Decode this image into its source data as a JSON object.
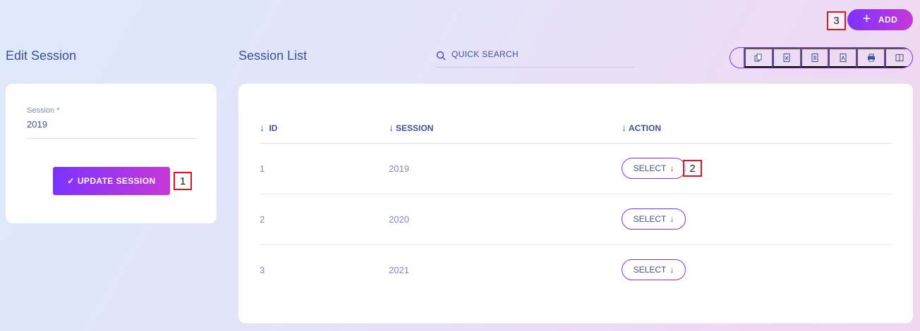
{
  "header": {
    "add_label": "ADD",
    "add_icon": "plus-icon"
  },
  "markers": [
    "1",
    "2",
    "3"
  ],
  "edit_panel": {
    "title": "Edit Session",
    "field_label": "Session *",
    "field_value": "2019",
    "update_label": "UPDATE SESSION",
    "check": "✓"
  },
  "list_panel": {
    "title": "Session List",
    "search_placeholder": "QUICK SEARCH",
    "export_buttons": [
      "copy-icon",
      "excel-icon",
      "csv-icon",
      "pdf-icon",
      "print-icon",
      "columns-icon"
    ],
    "columns": [
      "ID",
      "SESSION",
      "ACTION"
    ],
    "sort_arrow": "↓",
    "rows": [
      {
        "id": "1",
        "session": "2019",
        "action": "SELECT"
      },
      {
        "id": "2",
        "session": "2020",
        "action": "SELECT"
      },
      {
        "id": "3",
        "session": "2021",
        "action": "SELECT"
      }
    ]
  },
  "colors": {
    "accent": "#7c32ff",
    "accent2": "#c738d8",
    "text": "#415094",
    "muted": "#828bb2",
    "marker": "#e0141e"
  }
}
